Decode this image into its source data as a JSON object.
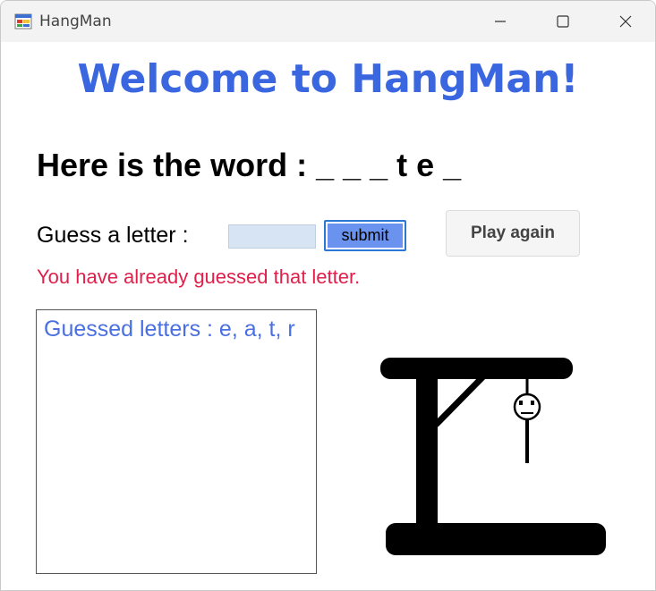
{
  "window": {
    "title": "HangMan",
    "icons": {
      "app": "app-icon",
      "minimize": "minimize-icon",
      "maximize": "maximize-icon",
      "close": "close-icon"
    }
  },
  "main": {
    "heading": "Welcome to HangMan!",
    "word_line": "Here is the word : _ _ _ t e _",
    "guess_label": "Guess a letter :",
    "guess_input_value": "",
    "submit_label": "submit",
    "play_again_label": "Play again",
    "error_message": "You have already guessed that letter.",
    "guessed_letters_text": "Guessed letters : e, a, t, r"
  },
  "colors": {
    "heading": "#3a66e0",
    "error": "#e0204a",
    "guessed_text": "#4a6fe0",
    "submit_fill": "#6a93f0",
    "input_fill": "#d6e4f3"
  }
}
